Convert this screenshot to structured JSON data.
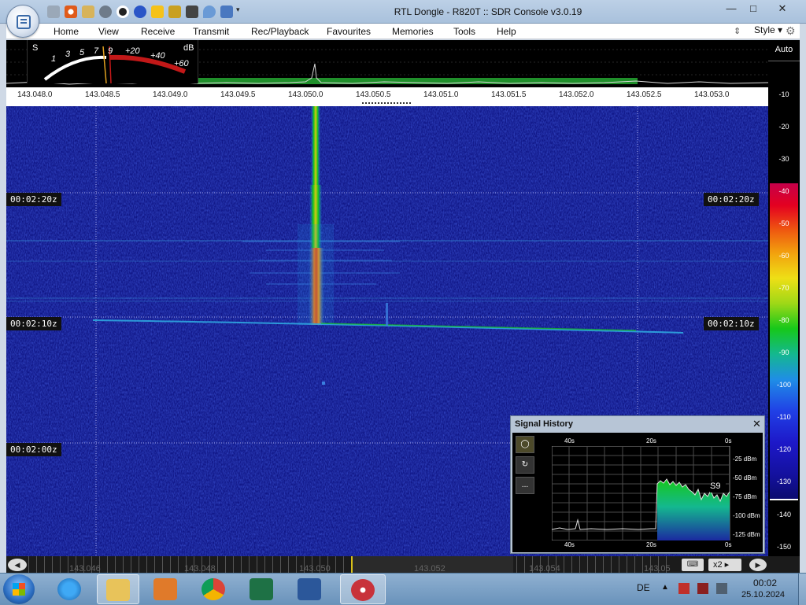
{
  "window": {
    "title": "RTL Dongle - R820T :: SDR Console v3.0.19",
    "minimize": "—",
    "maximize": "□",
    "close": "✕"
  },
  "menu": {
    "items": [
      "Home",
      "View",
      "Receive",
      "Transmit",
      "Rec/Playback",
      "Favourites",
      "Memories",
      "Tools",
      "Help"
    ],
    "style": "Style"
  },
  "meter": {
    "s_label": "S",
    "db_label": "dB",
    "s_scale": [
      "1",
      "3",
      "5",
      "7",
      "9"
    ],
    "plus_scale": [
      "+20",
      "+40",
      "+60"
    ]
  },
  "frequency_scale": [
    "143.048.0",
    "143.048.5",
    "143.049.0",
    "143.049.5",
    "143.050.0",
    "143.050.5",
    "143.051.0",
    "143.051.5",
    "143.052.0",
    "143.052.5",
    "143.053.0"
  ],
  "waterfall": {
    "time_labels": [
      "00:02:20z",
      "00:02:10z",
      "00:02:00z"
    ]
  },
  "db_scale": {
    "auto": "Auto",
    "ticks": [
      "-10",
      "-20",
      "-30",
      "-40",
      "-50",
      "-60",
      "-70",
      "-80",
      "-90",
      "-100",
      "-110",
      "-120",
      "-130",
      "-140",
      "-150"
    ]
  },
  "bottom_scale": [
    "143.046",
    "143.048",
    "143.050",
    "143.052",
    "143.054",
    "143.05"
  ],
  "bottom_controls": {
    "zoom": "x2"
  },
  "signal_history": {
    "title": "Signal History",
    "time_labels": [
      "40s",
      "20s",
      "0s"
    ],
    "dbm_labels": [
      "-25 dBm",
      "-50 dBm",
      "-75 dBm",
      "-100 dBm",
      "-125 dBm"
    ],
    "s_reading": "S9",
    "button_more": "..."
  },
  "taskbar": {
    "language": "DE",
    "time": "00:02",
    "date": "25.10.2024"
  },
  "colors": {
    "waterfall_bg": "#10158a",
    "signal_green": "#16c81a",
    "meter_red": "#c21818"
  }
}
